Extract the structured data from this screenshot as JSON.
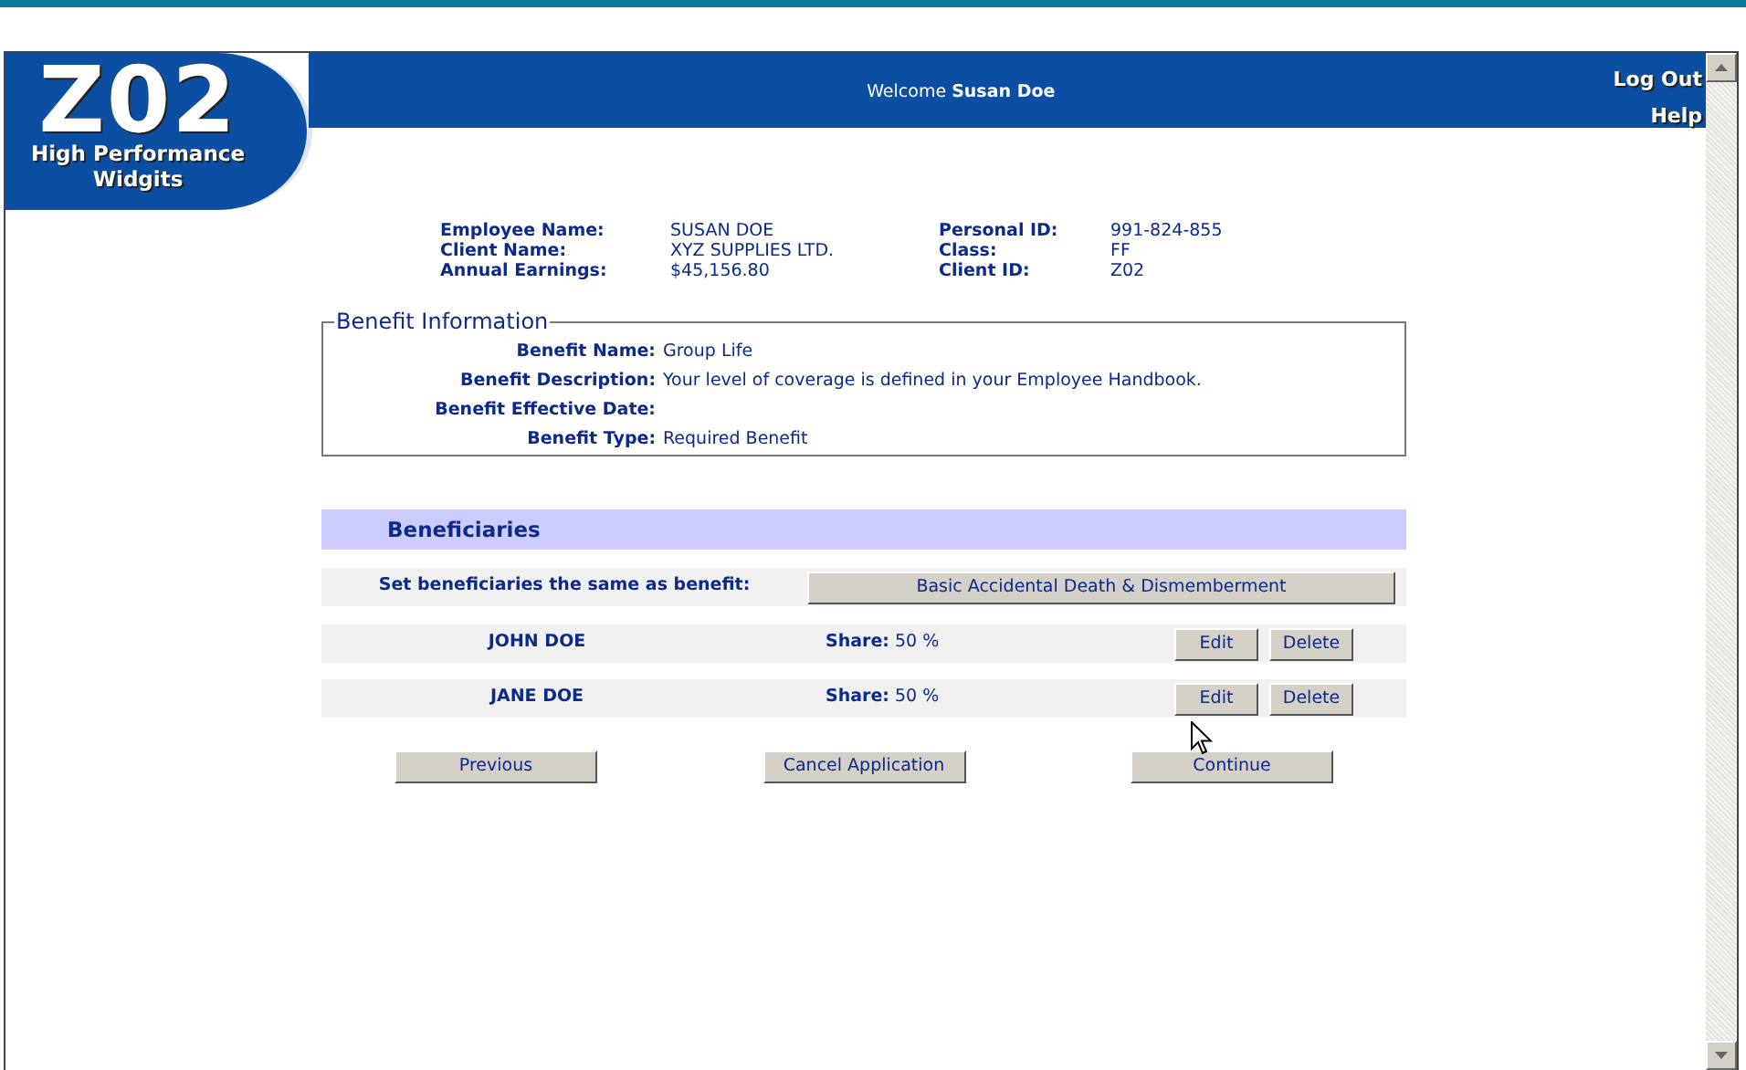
{
  "logo": {
    "mark": "Z02",
    "lines": [
      "High Performance",
      "Widgits"
    ]
  },
  "header": {
    "welcome": "Welcome **Susan Doe**",
    "links": [
      "Log Out",
      "Help"
    ]
  },
  "employee": {
    "left": [
      {
        "label": "Employee Name:",
        "value": "SUSAN DOE"
      },
      {
        "label": "Client Name:",
        "value": "XYZ SUPPLIES LTD."
      },
      {
        "label": "Annual Earnings:",
        "value": "$45,156.80"
      }
    ],
    "right": [
      {
        "label": "Personal ID:",
        "value": "991-824-855"
      },
      {
        "label": "Class:",
        "value": "FF"
      },
      {
        "label": "Client ID:",
        "value": "Z02"
      }
    ]
  },
  "benefit_information": {
    "title": "Benefit Information",
    "fields": [
      {
        "label": "Benefit Name:",
        "value": "Group Life"
      },
      {
        "label": "Benefit Description:",
        "value": "Your level of coverage is defined in your Employee Handbook."
      },
      {
        "label": "Benefit Effective Date:"
      },
      {
        "label": "Benefit Type:",
        "value": "Required Benefit"
      }
    ]
  },
  "beneficiaries": {
    "title": "Beneficiaries",
    "same_as_label": "Set beneficiaries the same as benefit:",
    "same_as_button": "Basic Accidental Death & Dismemberment",
    "rows": [
      {
        "name": "JOHN DOE",
        "share_label": "Share:",
        "share": "50 %",
        "actions": [
          "Edit",
          "Delete"
        ]
      },
      {
        "name": "JANE DOE",
        "share_label": "Share:",
        "share": "50 %",
        "actions": [
          "Edit",
          "Delete"
        ]
      }
    ]
  },
  "buttons": [
    "Previous",
    "Cancel Application",
    "Continue"
  ]
}
